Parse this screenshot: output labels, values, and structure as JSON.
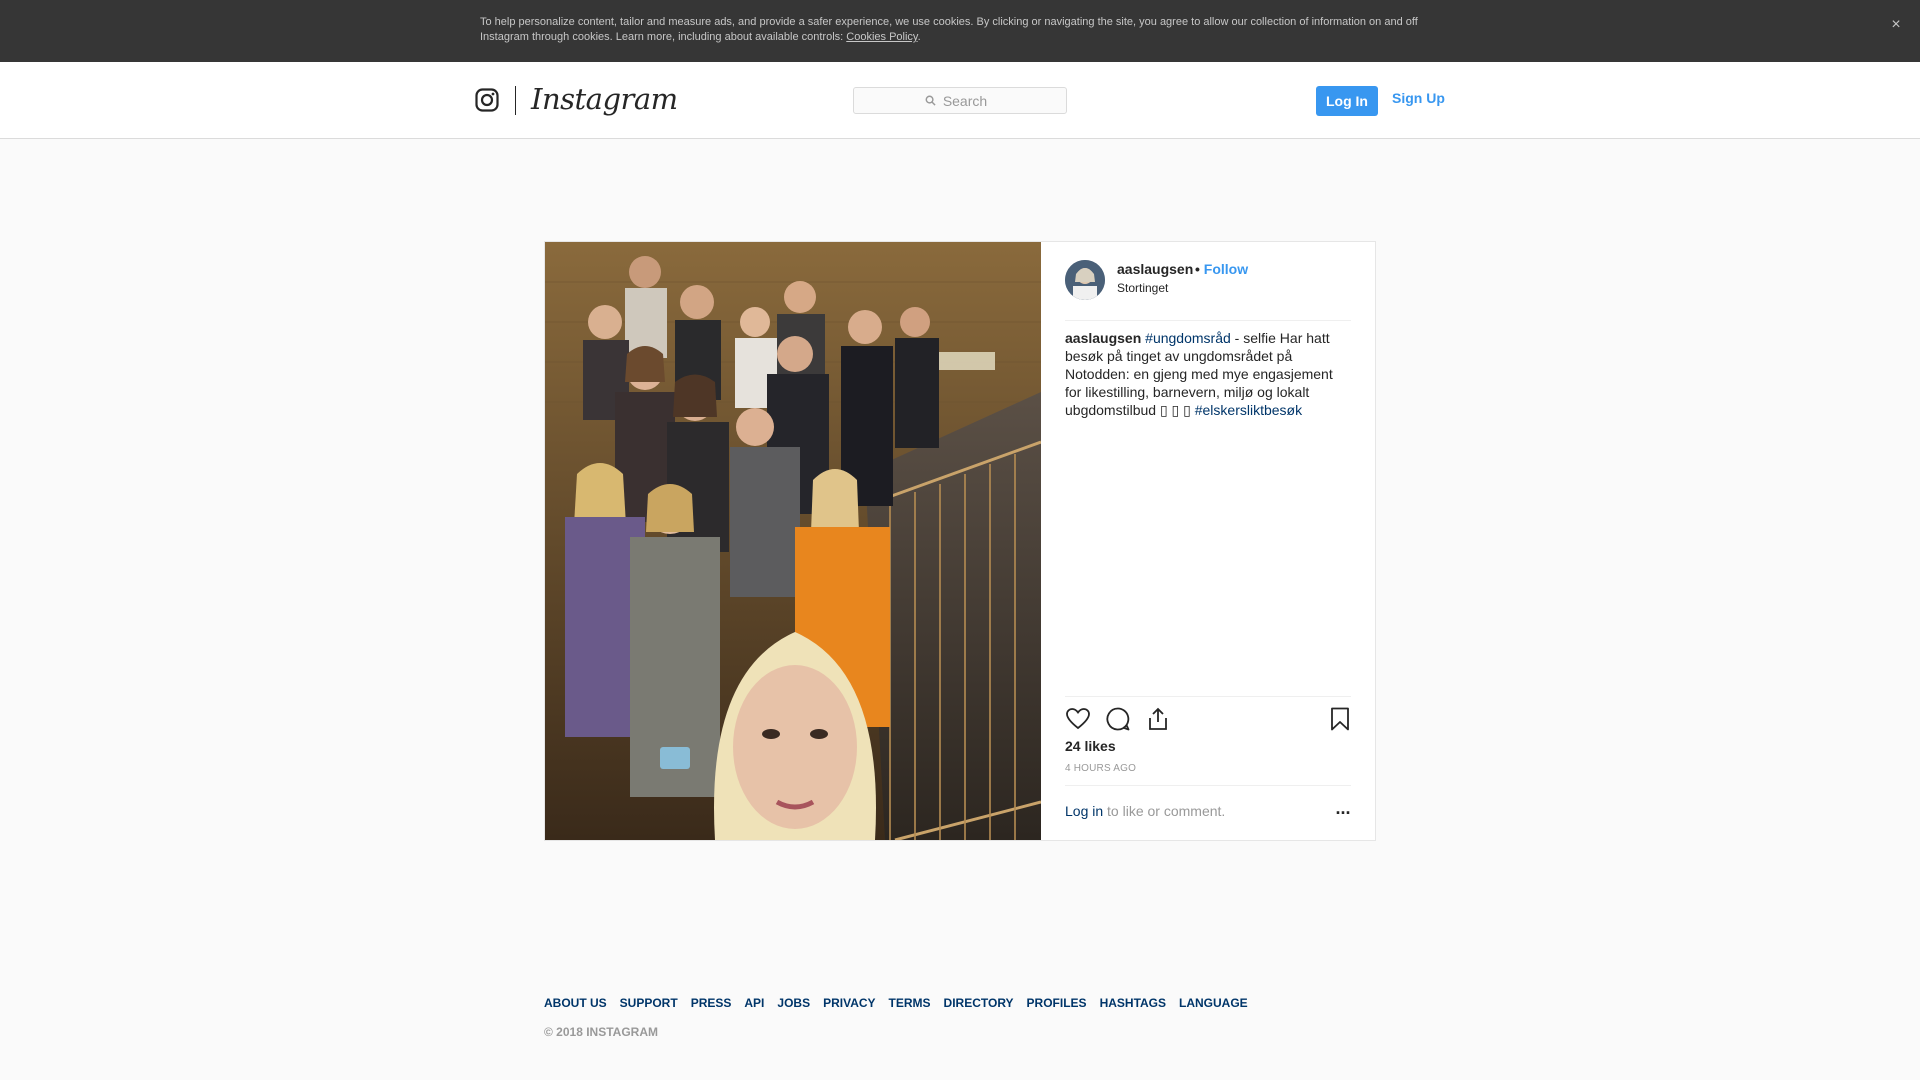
{
  "cookie_banner": {
    "text": "To help personalize content, tailor and measure ads, and provide a safer experience, we use cookies. By clicking or navigating the site, you agree to allow our collection of information on and off Instagram through cookies. Learn more, including about available controls: ",
    "link": "Cookies Policy",
    "close": "×"
  },
  "header": {
    "brand": "Instagram",
    "search_placeholder": "Search",
    "login_label": "Log In",
    "signup_label": "Sign Up"
  },
  "post": {
    "username": "aaslaugsen",
    "separator": "•",
    "follow_label": "Follow",
    "location": "Stortinget",
    "caption": {
      "username": "aaslaugsen",
      "hashtag_1": "#ungdomsråd",
      "text": " - selfie  Har hatt besøk på tinget av ungdomsrådet på Notodden: en gjeng med mye engasjement for likestilling, barnevern, miljø og lokalt ubgdomstilbud ▯ ▯ ▯ ",
      "hashtag_2": "#elskersliktbesøk"
    },
    "likes": "24 likes",
    "time": "4 HOURS AGO",
    "login_link": "Log in",
    "login_suffix": " to like or comment.",
    "more": "..."
  },
  "footer": {
    "links": [
      "ABOUT US",
      "SUPPORT",
      "PRESS",
      "API",
      "JOBS",
      "PRIVACY",
      "TERMS",
      "DIRECTORY",
      "PROFILES",
      "HASHTAGS",
      "LANGUAGE"
    ],
    "copyright": "© 2018 INSTAGRAM"
  },
  "icons": {
    "logo": "instagram-camera-icon",
    "search": "search-icon",
    "like": "heart-icon",
    "comment": "comment-icon",
    "share": "share-icon",
    "save": "bookmark-icon",
    "close": "close-icon"
  },
  "colors": {
    "accent": "#3897f0",
    "link_dark": "#003569",
    "banner_bg": "#363636",
    "page_bg": "#fafafa"
  }
}
